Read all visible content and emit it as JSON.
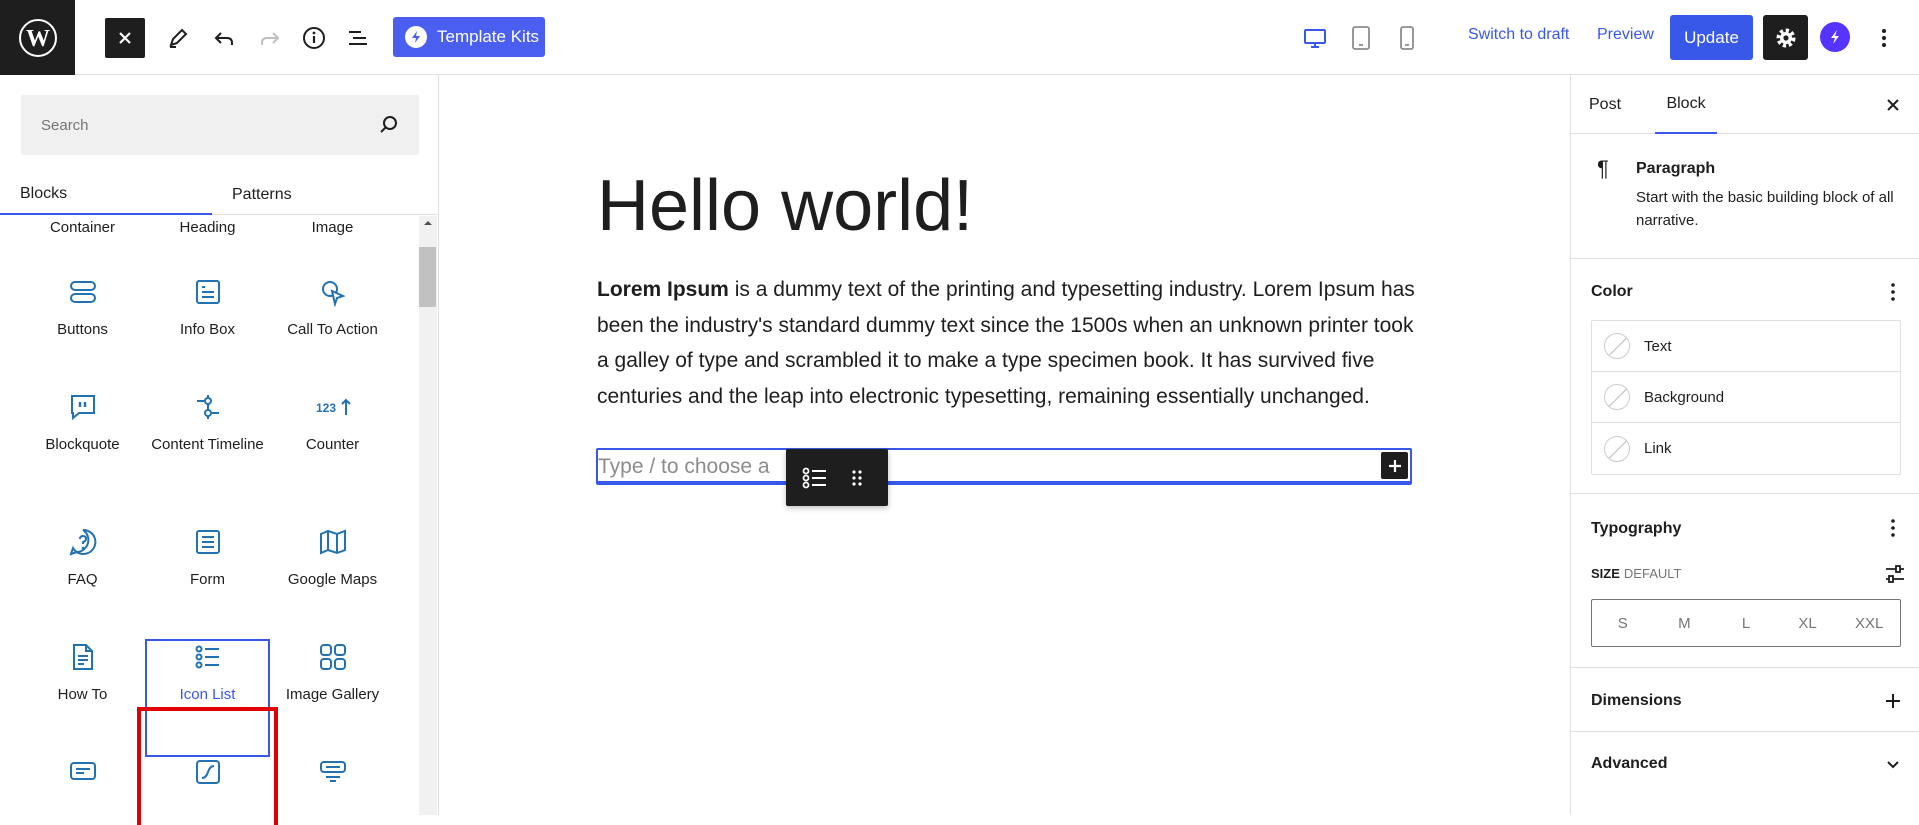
{
  "topbar": {
    "template_kits_label": "Template Kits",
    "switch_to_draft_label": "Switch to draft",
    "preview_label": "Preview",
    "update_label": "Update"
  },
  "inserter": {
    "search_placeholder": "Search",
    "tabs": [
      "Blocks",
      "Patterns"
    ],
    "blocks": [
      {
        "label": "Container",
        "icon": "container-icon"
      },
      {
        "label": "Heading",
        "icon": "heading-icon"
      },
      {
        "label": "Image",
        "icon": "image-icon"
      },
      {
        "label": "Buttons",
        "icon": "buttons-icon"
      },
      {
        "label": "Info Box",
        "icon": "info-box-icon"
      },
      {
        "label": "Call To Action",
        "icon": "call-to-action-icon"
      },
      {
        "label": "Blockquote",
        "icon": "blockquote-icon"
      },
      {
        "label": "Content Timeline",
        "icon": "content-timeline-icon"
      },
      {
        "label": "Counter",
        "icon": "counter-icon"
      },
      {
        "label": "FAQ",
        "icon": "faq-icon"
      },
      {
        "label": "Form",
        "icon": "form-icon"
      },
      {
        "label": "Google Maps",
        "icon": "google-maps-icon"
      },
      {
        "label": "How To",
        "icon": "how-to-icon"
      },
      {
        "label": "Icon List",
        "icon": "icon-list-icon",
        "selected": true
      },
      {
        "label": "Image Gallery",
        "icon": "image-gallery-icon"
      }
    ]
  },
  "canvas": {
    "title": "Hello world!",
    "paragraph_bold": "Lorem Ipsum",
    "paragraph_rest": " is a dummy text of the printing and typesetting industry. Lorem Ipsum has been the industry's standard dummy text since the 1500s when an unknown printer took a galley of type and scrambled it to make a type specimen book. It has survived five centuries and the leap into electronic typesetting, remaining essentially unchanged.",
    "new_block_placeholder": "Type / to choose a"
  },
  "settings": {
    "tabs": [
      "Post",
      "Block"
    ],
    "active_tab": "Block",
    "block_card": {
      "title": "Paragraph",
      "description": "Start with the basic building block of all narrative."
    },
    "color": {
      "heading": "Color",
      "items": [
        "Text",
        "Background",
        "Link"
      ]
    },
    "typography": {
      "heading": "Typography",
      "size_label": "SIZE",
      "size_value": "DEFAULT",
      "size_options": [
        "S",
        "M",
        "L",
        "XL",
        "XXL"
      ]
    },
    "dimensions_heading": "Dimensions",
    "advanced_heading": "Advanced"
  },
  "colors": {
    "accent": "#3858e9",
    "dark": "#1e1e1e",
    "highlight_red": "#e10000",
    "kits_button": "#4a5ff0",
    "spectra": "#5733ff"
  }
}
